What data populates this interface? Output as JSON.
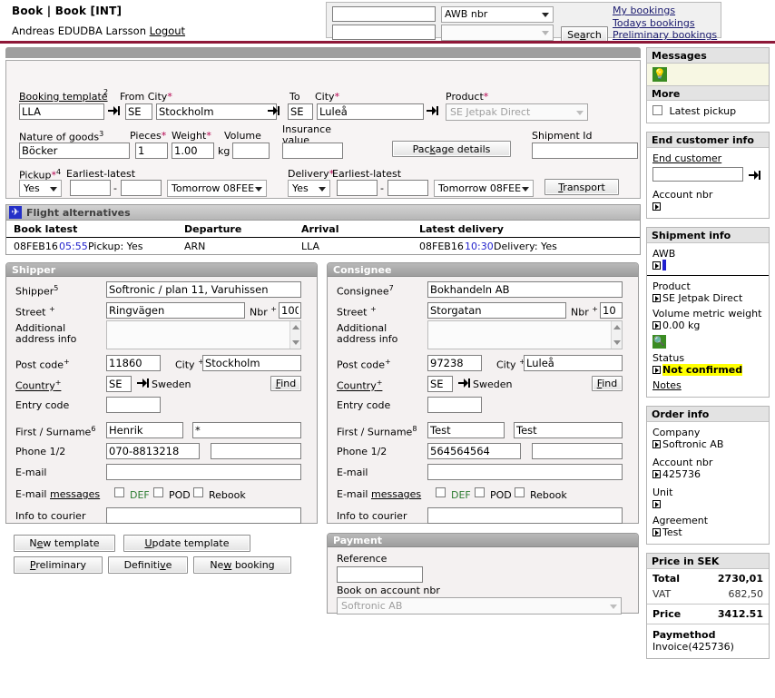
{
  "header": {
    "title": "Book | Book [INT]",
    "user": "Andreas EDUDBA Larsson",
    "logout": "Logout"
  },
  "search": {
    "field1_value": "",
    "field2_value": "",
    "type_selected": "AWB nbr",
    "type2_selected": "",
    "search_button": "Search",
    "links": [
      "My bookings",
      "Todays bookings",
      "Preliminary bookings"
    ]
  },
  "booking_form": {
    "booking_template_label": "Booking template",
    "booking_template_sup": "2",
    "booking_template_value": "LLA",
    "from_city_label": "From City",
    "from_country_value": "SE",
    "from_city_value": "Stockholm",
    "to_label": "To",
    "city_label": "City",
    "to_country_value": "SE",
    "to_city_value": "Luleå",
    "product_label": "Product",
    "product_value": "SE Jetpak Direct",
    "nature_label": "Nature of goods",
    "nature_sup": "3",
    "nature_value": "Böcker",
    "pieces_label": "Pieces",
    "pieces_value": "1",
    "weight_label": "Weight",
    "weight_value": "1.00",
    "weight_unit": "kg",
    "volume_label": "Volume",
    "volume_value": "",
    "insurance_label_l1": "Insurance",
    "insurance_label_l2": "value",
    "insurance_value": "",
    "package_details_button": "Package details",
    "shipment_id_label": "Shipment Id",
    "shipment_id_value": "",
    "pickup_label": "Pickup",
    "pickup_sup": "4",
    "earliest_latest_label": "Earliest-latest",
    "pickup_yesno": "Yes",
    "pickup_from": "",
    "pickup_to": "",
    "pickup_day": "Tomorrow 08FEE",
    "delivery_label": "Delivery",
    "delivery_yesno": "Yes",
    "delivery_from": "",
    "delivery_to": "",
    "delivery_day": "Tomorrow 08FEE",
    "transport_button": "Transport"
  },
  "flight": {
    "title": "Flight alternatives",
    "icon": "airplane-icon",
    "columns": [
      "Book latest",
      "Departure",
      "Arrival",
      "Latest delivery"
    ],
    "row": {
      "book_latest_date": "08FEB16",
      "book_latest_time": "05:55",
      "book_latest_pickup": "Pickup: Yes",
      "departure": "ARN",
      "arrival": "LLA",
      "latest_date": "08FEB16",
      "latest_time": "10:30",
      "latest_delivery": "Delivery: Yes"
    }
  },
  "shipper": {
    "title": "Shipper",
    "name_label": "Shipper",
    "name_sup": "5",
    "name_value": "Softronic / plan 11, Varuhissen",
    "street_label": "Street",
    "street_value": "Ringvägen",
    "nbr_label": "Nbr",
    "nbr_value": "100",
    "addl_label_l1": "Additional",
    "addl_label_l2": "address info",
    "addl_value": "",
    "postcode_label": "Post code",
    "postcode_value": "11860",
    "city_label": "City",
    "city_value": "Stockholm",
    "country_label": "Country",
    "country_code": "SE",
    "country_name": "Sweden",
    "find_button": "Find",
    "entry_label": "Entry code",
    "entry_value": "",
    "firstsur_label": "First / Surname",
    "firstsur_sup": "6",
    "first_value": "Henrik",
    "surname_value": "*",
    "phone_label": "Phone 1/2",
    "phone1_value": "070-8813218",
    "phone2_value": "",
    "email_label": "E-mail",
    "email_value": "",
    "emailmsg_label": "E-mail",
    "emailmsg_link": "messages",
    "chk_def": "DEF",
    "chk_pod": "POD",
    "chk_rebook": "Rebook",
    "info_label": "Info to courier",
    "info_value": ""
  },
  "consignee": {
    "title": "Consignee",
    "name_label": "Consignee",
    "name_sup": "7",
    "name_value": "Bokhandeln AB",
    "street_label": "Street",
    "street_value": "Storgatan",
    "nbr_label": "Nbr",
    "nbr_value": "10",
    "addl_label_l1": "Additional",
    "addl_label_l2": "address info",
    "addl_value": "",
    "postcode_label": "Post code",
    "postcode_value": "97238",
    "city_label": "City",
    "city_value": "Luleå",
    "country_label": "Country",
    "country_code": "SE",
    "country_name": "Sweden",
    "find_button": "Find",
    "entry_label": "Entry code",
    "entry_value": "",
    "firstsur_label": "First / Surname",
    "firstsur_sup": "8",
    "first_value": "Test",
    "surname_value": "Test",
    "phone_label": "Phone 1/2",
    "phone1_value": "564564564",
    "phone2_value": "",
    "email_label": "E-mail",
    "email_value": "",
    "emailmsg_label": "E-mail",
    "emailmsg_link": "messages",
    "chk_def": "DEF",
    "chk_pod": "POD",
    "chk_rebook": "Rebook",
    "info_label": "Info to courier",
    "info_value": ""
  },
  "actions": {
    "new_template": "New template",
    "update_template": "Update template",
    "preliminary": "Preliminary",
    "definitive": "Definitive",
    "new_booking": "New booking"
  },
  "payment": {
    "title": "Payment",
    "reference_label": "Reference",
    "reference_value": "",
    "account_label": "Book on account nbr",
    "account_value": "Softronic AB"
  },
  "sidebar": {
    "messages": {
      "title": "Messages",
      "icon": "lightbulb-icon"
    },
    "more": {
      "title": "More",
      "checkbox_label": "Latest pickup"
    },
    "end_customer": {
      "title": "End customer info",
      "link": "End customer",
      "input_value": "",
      "account_label": "Account nbr",
      "account_value": ""
    },
    "shipment_info": {
      "title": "Shipment info",
      "awb_label": "AWB",
      "awb_value": "",
      "product_label": "Product",
      "product_value": "SE Jetpak Direct",
      "volume_label": "Volume metric weight",
      "volume_value": "0.00 kg",
      "magnifier_icon": "magnifier-icon",
      "status_label": "Status",
      "status_value": "Not confirmed",
      "notes_link": "Notes"
    },
    "order_info": {
      "title": "Order info",
      "company_label": "Company",
      "company_value": "Softronic AB",
      "account_label": "Account nbr",
      "account_value": "425736",
      "unit_label": "Unit",
      "unit_value": "",
      "agreement_label": "Agreement",
      "agreement_value": "Test"
    },
    "price": {
      "title": "Price in SEK",
      "total_label": "Total",
      "total_value": "2730,01",
      "vat_label": "VAT",
      "vat_value": "682,50",
      "price_label": "Price",
      "price_value": "3412.51",
      "paymethod_label": "Paymethod",
      "paymethod_value": "Invoice(425736)"
    }
  }
}
